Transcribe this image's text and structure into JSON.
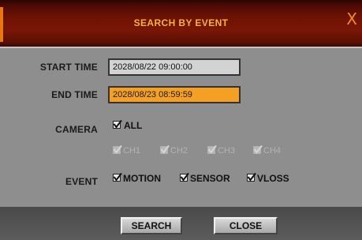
{
  "dialog": {
    "title": "SEARCH BY EVENT",
    "close_glyph": "X"
  },
  "start_time": {
    "label": "START TIME",
    "value": "2028/08/22 09:00:00"
  },
  "end_time": {
    "label": "END TIME",
    "value": "2028/08/23 08:59:59"
  },
  "camera": {
    "label": "CAMERA",
    "all": {
      "label": "ALL",
      "checked": true
    },
    "channels": [
      {
        "label": "CH1",
        "checked": true,
        "enabled": false
      },
      {
        "label": "CH2",
        "checked": true,
        "enabled": false
      },
      {
        "label": "CH3",
        "checked": true,
        "enabled": false
      },
      {
        "label": "CH4",
        "checked": true,
        "enabled": false
      }
    ]
  },
  "event": {
    "label": "EVENT",
    "types": [
      {
        "label": "MOTION",
        "checked": true
      },
      {
        "label": "SENSOR",
        "checked": true
      },
      {
        "label": "VLOSS",
        "checked": true
      }
    ]
  },
  "buttons": {
    "search": "SEARCH",
    "close": "CLOSE"
  },
  "colors": {
    "title_text": "#f3b33c",
    "titlebar": "#7a1606",
    "active_field": "#f5a024",
    "panel": "#8e8e8e"
  }
}
